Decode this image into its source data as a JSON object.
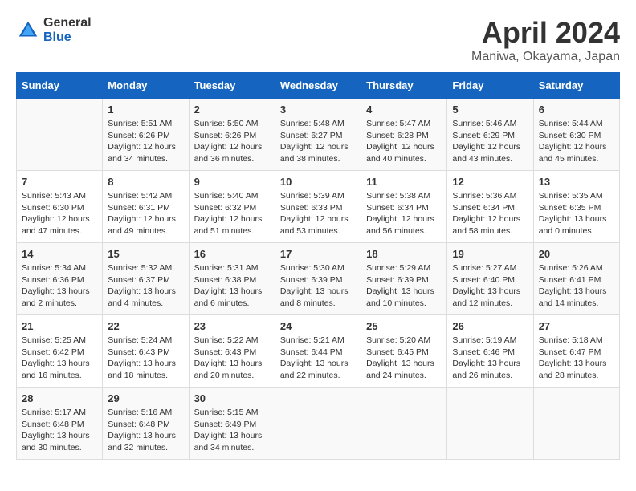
{
  "logo": {
    "general": "General",
    "blue": "Blue"
  },
  "title": "April 2024",
  "location": "Maniwa, Okayama, Japan",
  "days_header": [
    "Sunday",
    "Monday",
    "Tuesday",
    "Wednesday",
    "Thursday",
    "Friday",
    "Saturday"
  ],
  "weeks": [
    [
      {
        "day": "",
        "sunrise": "",
        "sunset": "",
        "daylight": ""
      },
      {
        "day": "1",
        "sunrise": "Sunrise: 5:51 AM",
        "sunset": "Sunset: 6:26 PM",
        "daylight": "Daylight: 12 hours and 34 minutes."
      },
      {
        "day": "2",
        "sunrise": "Sunrise: 5:50 AM",
        "sunset": "Sunset: 6:26 PM",
        "daylight": "Daylight: 12 hours and 36 minutes."
      },
      {
        "day": "3",
        "sunrise": "Sunrise: 5:48 AM",
        "sunset": "Sunset: 6:27 PM",
        "daylight": "Daylight: 12 hours and 38 minutes."
      },
      {
        "day": "4",
        "sunrise": "Sunrise: 5:47 AM",
        "sunset": "Sunset: 6:28 PM",
        "daylight": "Daylight: 12 hours and 40 minutes."
      },
      {
        "day": "5",
        "sunrise": "Sunrise: 5:46 AM",
        "sunset": "Sunset: 6:29 PM",
        "daylight": "Daylight: 12 hours and 43 minutes."
      },
      {
        "day": "6",
        "sunrise": "Sunrise: 5:44 AM",
        "sunset": "Sunset: 6:30 PM",
        "daylight": "Daylight: 12 hours and 45 minutes."
      }
    ],
    [
      {
        "day": "7",
        "sunrise": "Sunrise: 5:43 AM",
        "sunset": "Sunset: 6:30 PM",
        "daylight": "Daylight: 12 hours and 47 minutes."
      },
      {
        "day": "8",
        "sunrise": "Sunrise: 5:42 AM",
        "sunset": "Sunset: 6:31 PM",
        "daylight": "Daylight: 12 hours and 49 minutes."
      },
      {
        "day": "9",
        "sunrise": "Sunrise: 5:40 AM",
        "sunset": "Sunset: 6:32 PM",
        "daylight": "Daylight: 12 hours and 51 minutes."
      },
      {
        "day": "10",
        "sunrise": "Sunrise: 5:39 AM",
        "sunset": "Sunset: 6:33 PM",
        "daylight": "Daylight: 12 hours and 53 minutes."
      },
      {
        "day": "11",
        "sunrise": "Sunrise: 5:38 AM",
        "sunset": "Sunset: 6:34 PM",
        "daylight": "Daylight: 12 hours and 56 minutes."
      },
      {
        "day": "12",
        "sunrise": "Sunrise: 5:36 AM",
        "sunset": "Sunset: 6:34 PM",
        "daylight": "Daylight: 12 hours and 58 minutes."
      },
      {
        "day": "13",
        "sunrise": "Sunrise: 5:35 AM",
        "sunset": "Sunset: 6:35 PM",
        "daylight": "Daylight: 13 hours and 0 minutes."
      }
    ],
    [
      {
        "day": "14",
        "sunrise": "Sunrise: 5:34 AM",
        "sunset": "Sunset: 6:36 PM",
        "daylight": "Daylight: 13 hours and 2 minutes."
      },
      {
        "day": "15",
        "sunrise": "Sunrise: 5:32 AM",
        "sunset": "Sunset: 6:37 PM",
        "daylight": "Daylight: 13 hours and 4 minutes."
      },
      {
        "day": "16",
        "sunrise": "Sunrise: 5:31 AM",
        "sunset": "Sunset: 6:38 PM",
        "daylight": "Daylight: 13 hours and 6 minutes."
      },
      {
        "day": "17",
        "sunrise": "Sunrise: 5:30 AM",
        "sunset": "Sunset: 6:39 PM",
        "daylight": "Daylight: 13 hours and 8 minutes."
      },
      {
        "day": "18",
        "sunrise": "Sunrise: 5:29 AM",
        "sunset": "Sunset: 6:39 PM",
        "daylight": "Daylight: 13 hours and 10 minutes."
      },
      {
        "day": "19",
        "sunrise": "Sunrise: 5:27 AM",
        "sunset": "Sunset: 6:40 PM",
        "daylight": "Daylight: 13 hours and 12 minutes."
      },
      {
        "day": "20",
        "sunrise": "Sunrise: 5:26 AM",
        "sunset": "Sunset: 6:41 PM",
        "daylight": "Daylight: 13 hours and 14 minutes."
      }
    ],
    [
      {
        "day": "21",
        "sunrise": "Sunrise: 5:25 AM",
        "sunset": "Sunset: 6:42 PM",
        "daylight": "Daylight: 13 hours and 16 minutes."
      },
      {
        "day": "22",
        "sunrise": "Sunrise: 5:24 AM",
        "sunset": "Sunset: 6:43 PM",
        "daylight": "Daylight: 13 hours and 18 minutes."
      },
      {
        "day": "23",
        "sunrise": "Sunrise: 5:22 AM",
        "sunset": "Sunset: 6:43 PM",
        "daylight": "Daylight: 13 hours and 20 minutes."
      },
      {
        "day": "24",
        "sunrise": "Sunrise: 5:21 AM",
        "sunset": "Sunset: 6:44 PM",
        "daylight": "Daylight: 13 hours and 22 minutes."
      },
      {
        "day": "25",
        "sunrise": "Sunrise: 5:20 AM",
        "sunset": "Sunset: 6:45 PM",
        "daylight": "Daylight: 13 hours and 24 minutes."
      },
      {
        "day": "26",
        "sunrise": "Sunrise: 5:19 AM",
        "sunset": "Sunset: 6:46 PM",
        "daylight": "Daylight: 13 hours and 26 minutes."
      },
      {
        "day": "27",
        "sunrise": "Sunrise: 5:18 AM",
        "sunset": "Sunset: 6:47 PM",
        "daylight": "Daylight: 13 hours and 28 minutes."
      }
    ],
    [
      {
        "day": "28",
        "sunrise": "Sunrise: 5:17 AM",
        "sunset": "Sunset: 6:48 PM",
        "daylight": "Daylight: 13 hours and 30 minutes."
      },
      {
        "day": "29",
        "sunrise": "Sunrise: 5:16 AM",
        "sunset": "Sunset: 6:48 PM",
        "daylight": "Daylight: 13 hours and 32 minutes."
      },
      {
        "day": "30",
        "sunrise": "Sunrise: 5:15 AM",
        "sunset": "Sunset: 6:49 PM",
        "daylight": "Daylight: 13 hours and 34 minutes."
      },
      {
        "day": "",
        "sunrise": "",
        "sunset": "",
        "daylight": ""
      },
      {
        "day": "",
        "sunrise": "",
        "sunset": "",
        "daylight": ""
      },
      {
        "day": "",
        "sunrise": "",
        "sunset": "",
        "daylight": ""
      },
      {
        "day": "",
        "sunrise": "",
        "sunset": "",
        "daylight": ""
      }
    ]
  ]
}
